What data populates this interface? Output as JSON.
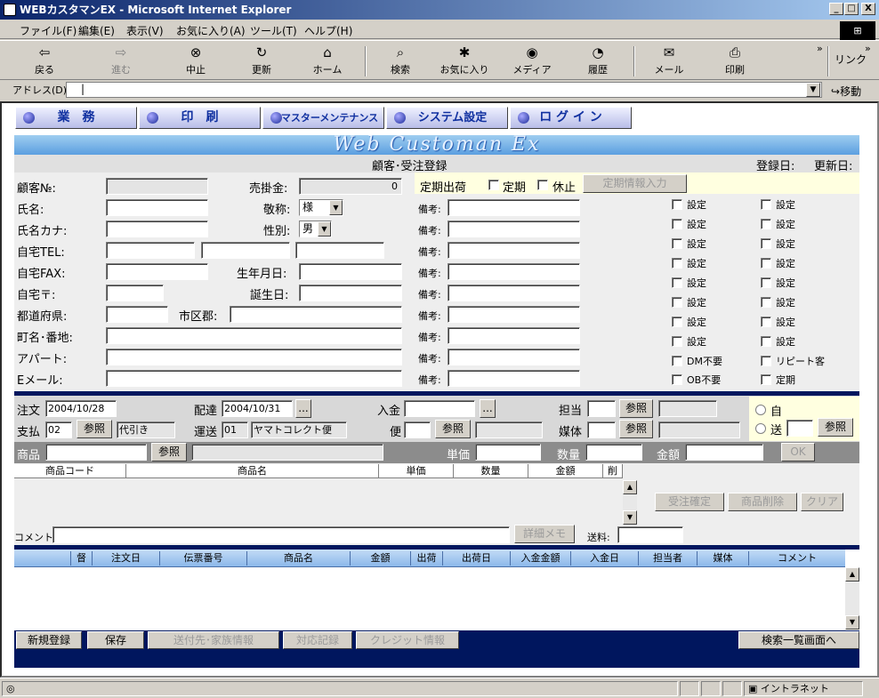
{
  "window": {
    "title": "WEBカスタマンEX - Microsoft Internet Explorer",
    "min": "_",
    "max": "□",
    "close": "X"
  },
  "menu": [
    "ファイル(F)",
    "編集(E)",
    "表示(V)",
    "お気に入り(A)",
    "ツール(T)",
    "ヘルプ(H)"
  ],
  "toolbar": {
    "back": "戻る",
    "forward": "進む",
    "stop": "中止",
    "refresh": "更新",
    "home": "ホーム",
    "search": "検索",
    "favorites": "お気に入り",
    "media": "メディア",
    "history": "履歴",
    "mail": "メール",
    "print": "印刷",
    "links": "リンク"
  },
  "address": {
    "label": "アドレス(D)",
    "value": "|",
    "go": "移動"
  },
  "nav": [
    "業　務",
    "印　刷",
    "マスターメンテナンス",
    "システム設定",
    "ロ グ イ ン"
  ],
  "banner": "Web Customan Ex",
  "header": {
    "title": "顧客･受注登録",
    "reg_date": "登録日:",
    "upd_date": "更新日:"
  },
  "customer": {
    "no_label": "顧客№:",
    "no": "",
    "ar_label": "売掛金:",
    "ar": "0",
    "periodic_label": "定期出荷",
    "periodic_cb": "定期",
    "pause_cb": "休止",
    "periodic_btn": "定期情報入力",
    "name_label": "氏名:",
    "honorific_label": "敬称:",
    "honorific": "様",
    "kana_label": "氏名カナ:",
    "gender_label": "性別:",
    "gender": "男",
    "tel_label": "自宅TEL:",
    "fax_label": "自宅FAX:",
    "birth_label": "生年月日:",
    "zip_label": "自宅〒:",
    "bday_label": "誕生日:",
    "pref_label": "都道府県:",
    "city_label": "市区郡:",
    "town_label": "町名･番地:",
    "apt_label": "アパート:",
    "email_label": "Eメール:",
    "memo_label": "備考:",
    "setting": "設定",
    "dm": "DM不要",
    "repeat": "リピート客",
    "ob": "OB不要",
    "teiki": "定期"
  },
  "order": {
    "order_label": "注文",
    "order_date": "2004/10/28",
    "delivery_label": "配達",
    "delivery_date": "2004/10/31",
    "ellipsis": "...",
    "payment_label": "入金",
    "staff_label": "担当",
    "ref": "参照",
    "pay_label": "支払",
    "pay_code": "02",
    "pay_name": "代引き",
    "ship_label": "運送",
    "ship_code": "01",
    "ship_name": "ヤマトコレクト便",
    "flight_label": "便",
    "media_label": "媒体",
    "radio_self": "自",
    "radio_send": "送"
  },
  "product": {
    "label": "商品",
    "price_label": "単価",
    "qty_label": "数量",
    "amount_label": "金額",
    "ok": "OK",
    "columns": [
      "商品コード",
      "商品名",
      "単価",
      "数量",
      "金額",
      "削"
    ],
    "confirm": "受注確定",
    "delete": "商品削除",
    "clear": "クリア",
    "comment_label": "コメント",
    "memo_btn": "詳細メモ",
    "postage_label": "送料:"
  },
  "history": {
    "columns": [
      "督",
      "注文日",
      "伝票番号",
      "商品名",
      "金額",
      "出荷",
      "出荷日",
      "入金金額",
      "入金日",
      "担当者",
      "媒体",
      "コメント"
    ]
  },
  "bottom": {
    "new": "新規登録",
    "save": "保存",
    "family": "送付先･家族情報",
    "record": "対応記録",
    "credit": "クレジット情報",
    "search": "検索一覧画面へ"
  },
  "status": {
    "zone": "イントラネット"
  }
}
